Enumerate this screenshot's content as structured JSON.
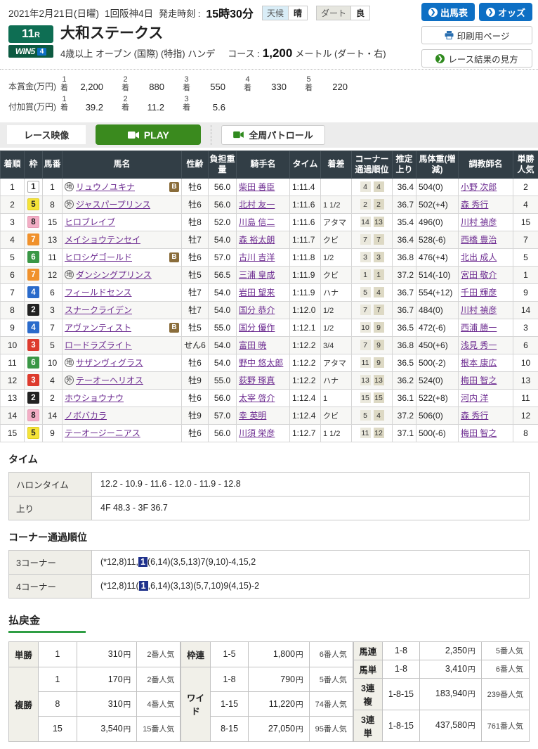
{
  "header": {
    "date": "2021年2月21日(日曜)",
    "meeting": "1回阪神4日",
    "start_label": "発走時刻 :",
    "start_time": "15時30分",
    "weather_label": "天候",
    "weather_value": "晴",
    "surface_label": "ダート",
    "surface_value": "良",
    "buttons": {
      "entries": "出馬表",
      "odds": "オッズ",
      "print": "印刷用ページ",
      "guide": "レース結果の見方"
    }
  },
  "race": {
    "number": "11",
    "number_suffix": "R",
    "win5_label": "WIN5",
    "win5_num": "4",
    "title": "大和ステークス",
    "conditions": "4歳以上  オープン (国際) (特指)  ハンデ",
    "course_label": "コース :",
    "course_value": "1,200",
    "course_unit": "メートル (ダート・右)"
  },
  "prizes": {
    "main_label": "本賞金(万円)",
    "extra_label": "付加賞(万円)",
    "rank_suffix": "着",
    "main": [
      {
        "rank": "1",
        "value": "2,200"
      },
      {
        "rank": "2",
        "value": "880"
      },
      {
        "rank": "3",
        "value": "550"
      },
      {
        "rank": "4",
        "value": "330"
      },
      {
        "rank": "5",
        "value": "220"
      }
    ],
    "extra": [
      {
        "rank": "1",
        "value": "39.2"
      },
      {
        "rank": "2",
        "value": "11.2"
      },
      {
        "rank": "3",
        "value": "5.6"
      }
    ]
  },
  "video": {
    "race_video": "レース映像",
    "play": "PLAY",
    "patrol": "全周パトロール"
  },
  "results": {
    "headers": [
      "着順",
      "枠",
      "馬番",
      "馬名",
      "性齢",
      "負担重量",
      "騎手名",
      "タイム",
      "着差",
      "コーナー通過順位",
      "推定上り",
      "馬体重(増減)",
      "調教師名",
      "単勝人気"
    ],
    "rows": [
      {
        "pos": "1",
        "frame": "1",
        "num": "1",
        "prefix": "地",
        "name": "リュウノユキナ",
        "blinker": true,
        "sexage": "牡6",
        "load": "56.0",
        "jockey": "柴田 善臣",
        "time": "1:11.4",
        "margin": "",
        "corners": [
          "4",
          "4"
        ],
        "last3f": "36.4",
        "weight": "504(0)",
        "trainer": "小野 次郎",
        "fav": "2"
      },
      {
        "pos": "2",
        "frame": "5",
        "num": "8",
        "prefix": "外",
        "name": "ジャスパープリンス",
        "blinker": false,
        "sexage": "牡6",
        "load": "56.0",
        "jockey": "北村 友一",
        "time": "1:11.6",
        "margin": "1 1/2",
        "corners": [
          "2",
          "2"
        ],
        "last3f": "36.7",
        "weight": "502(+4)",
        "trainer": "森 秀行",
        "fav": "4"
      },
      {
        "pos": "3",
        "frame": "8",
        "num": "15",
        "prefix": "",
        "name": "ヒロブレイブ",
        "blinker": false,
        "sexage": "牡8",
        "load": "52.0",
        "jockey": "川島 信二",
        "time": "1:11.6",
        "margin": "アタマ",
        "corners": [
          "14",
          "13"
        ],
        "last3f": "35.4",
        "weight": "496(0)",
        "trainer": "川村 禎彦",
        "fav": "15"
      },
      {
        "pos": "4",
        "frame": "7",
        "num": "13",
        "prefix": "",
        "name": "メイショウテンセイ",
        "blinker": false,
        "sexage": "牡7",
        "load": "54.0",
        "jockey": "森 裕太朗",
        "time": "1:11.7",
        "margin": "クビ",
        "corners": [
          "7",
          "7"
        ],
        "last3f": "36.4",
        "weight": "528(-6)",
        "trainer": "西橋 豊治",
        "fav": "7"
      },
      {
        "pos": "5",
        "frame": "6",
        "num": "11",
        "prefix": "",
        "name": "ヒロシゲゴールド",
        "blinker": true,
        "sexage": "牡6",
        "load": "57.0",
        "jockey": "古川 吉洋",
        "time": "1:11.8",
        "margin": "1/2",
        "corners": [
          "3",
          "3"
        ],
        "last3f": "36.8",
        "weight": "476(+4)",
        "trainer": "北出 成人",
        "fav": "5"
      },
      {
        "pos": "6",
        "frame": "7",
        "num": "12",
        "prefix": "地",
        "name": "ダンシングプリンス",
        "blinker": false,
        "sexage": "牡5",
        "load": "56.5",
        "jockey": "三浦 皇成",
        "time": "1:11.9",
        "margin": "クビ",
        "corners": [
          "1",
          "1"
        ],
        "last3f": "37.2",
        "weight": "514(-10)",
        "trainer": "宮田 敬介",
        "fav": "1"
      },
      {
        "pos": "7",
        "frame": "4",
        "num": "6",
        "prefix": "",
        "name": "フィールドセンス",
        "blinker": false,
        "sexage": "牡7",
        "load": "54.0",
        "jockey": "岩田 望来",
        "time": "1:11.9",
        "margin": "ハナ",
        "corners": [
          "5",
          "4"
        ],
        "last3f": "36.7",
        "weight": "554(+12)",
        "trainer": "千田 輝彦",
        "fav": "9"
      },
      {
        "pos": "8",
        "frame": "2",
        "num": "3",
        "prefix": "",
        "name": "スナークライデン",
        "blinker": false,
        "sexage": "牡7",
        "load": "54.0",
        "jockey": "国分 恭介",
        "time": "1:12.0",
        "margin": "1/2",
        "corners": [
          "7",
          "7"
        ],
        "last3f": "36.7",
        "weight": "484(0)",
        "trainer": "川村 禎彦",
        "fav": "14"
      },
      {
        "pos": "9",
        "frame": "4",
        "num": "7",
        "prefix": "",
        "name": "アヴァンティスト",
        "blinker": true,
        "sexage": "牡5",
        "load": "55.0",
        "jockey": "国分 優作",
        "time": "1:12.1",
        "margin": "1/2",
        "corners": [
          "10",
          "9"
        ],
        "last3f": "36.5",
        "weight": "472(-6)",
        "trainer": "西浦 勝一",
        "fav": "3"
      },
      {
        "pos": "10",
        "frame": "3",
        "num": "5",
        "prefix": "",
        "name": "ロードラズライト",
        "blinker": false,
        "sexage": "せん6",
        "load": "54.0",
        "jockey": "富田 暁",
        "time": "1:12.2",
        "margin": "3/4",
        "corners": [
          "7",
          "9"
        ],
        "last3f": "36.8",
        "weight": "450(+6)",
        "trainer": "浅見 秀一",
        "fav": "6"
      },
      {
        "pos": "11",
        "frame": "6",
        "num": "10",
        "prefix": "地",
        "name": "サザンヴィグラス",
        "blinker": false,
        "sexage": "牡6",
        "load": "54.0",
        "jockey": "野中 悠太郎",
        "time": "1:12.2",
        "margin": "アタマ",
        "corners": [
          "11",
          "9"
        ],
        "last3f": "36.5",
        "weight": "500(-2)",
        "trainer": "根本 康広",
        "fav": "10"
      },
      {
        "pos": "12",
        "frame": "3",
        "num": "4",
        "prefix": "外",
        "name": "テーオーヘリオス",
        "blinker": false,
        "sexage": "牡9",
        "load": "55.0",
        "jockey": "荻野 琢真",
        "time": "1:12.2",
        "margin": "ハナ",
        "corners": [
          "13",
          "13"
        ],
        "last3f": "36.2",
        "weight": "524(0)",
        "trainer": "梅田 智之",
        "fav": "13"
      },
      {
        "pos": "13",
        "frame": "2",
        "num": "2",
        "prefix": "",
        "name": "ホウショウナウ",
        "blinker": false,
        "sexage": "牡6",
        "load": "56.0",
        "jockey": "太宰 啓介",
        "time": "1:12.4",
        "margin": "1",
        "corners": [
          "15",
          "15"
        ],
        "last3f": "36.1",
        "weight": "522(+8)",
        "trainer": "河内 洋",
        "fav": "11"
      },
      {
        "pos": "14",
        "frame": "8",
        "num": "14",
        "prefix": "",
        "name": "ノボバカラ",
        "blinker": false,
        "sexage": "牡9",
        "load": "57.0",
        "jockey": "幸 英明",
        "time": "1:12.4",
        "margin": "クビ",
        "corners": [
          "5",
          "4"
        ],
        "last3f": "37.2",
        "weight": "506(0)",
        "trainer": "森 秀行",
        "fav": "12"
      },
      {
        "pos": "15",
        "frame": "5",
        "num": "9",
        "prefix": "",
        "name": "テーオージーニアス",
        "blinker": false,
        "sexage": "牡6",
        "load": "56.0",
        "jockey": "川須 栄彦",
        "time": "1:12.7",
        "margin": "1 1/2",
        "corners": [
          "11",
          "12"
        ],
        "last3f": "37.1",
        "weight": "500(-6)",
        "trainer": "梅田 智之",
        "fav": "8"
      }
    ]
  },
  "time_section": {
    "title": "タイム",
    "furlong_label": "ハロンタイム",
    "furlong": "12.2 - 10.9 - 11.6 - 12.0 - 11.9 - 12.8",
    "agari_label": "上り",
    "agari": "4F 48.3 - 3F 36.7"
  },
  "corner_section": {
    "title": "コーナー通過順位",
    "rows": [
      {
        "label": "3コーナー",
        "pre": "(*12,8)11,",
        "hl": "1",
        "post": "(6,14)(3,5,13)7(9,10)-4,15,2"
      },
      {
        "label": "4コーナー",
        "pre": "(*12,8)11(",
        "hl": "1",
        "post": ",6,14)(3,13)(5,7,10)9(4,15)-2"
      }
    ]
  },
  "payout": {
    "title": "払戻金",
    "yen": "円",
    "groups": [
      [
        {
          "type": "単勝",
          "rows": [
            [
              "1",
              "310",
              "2番人気"
            ]
          ]
        },
        {
          "type": "複勝",
          "rows": [
            [
              "1",
              "170",
              "2番人気"
            ],
            [
              "8",
              "310",
              "4番人気"
            ],
            [
              "15",
              "3,540",
              "15番人気"
            ]
          ]
        }
      ],
      [
        {
          "type": "枠連",
          "rows": [
            [
              "1-5",
              "1,800",
              "6番人気"
            ]
          ]
        },
        {
          "type": "ワイド",
          "rows": [
            [
              "1-8",
              "790",
              "5番人気"
            ],
            [
              "1-15",
              "11,220",
              "74番人気"
            ],
            [
              "8-15",
              "27,050",
              "95番人気"
            ]
          ]
        }
      ],
      [
        {
          "type": "馬連",
          "rows": [
            [
              "1-8",
              "2,350",
              "5番人気"
            ]
          ]
        },
        {
          "type": "馬単",
          "rows": [
            [
              "1-8",
              "3,410",
              "6番人気"
            ]
          ]
        },
        {
          "type": "3連複",
          "rows": [
            [
              "1-8-15",
              "183,940",
              "239番人気"
            ]
          ]
        },
        {
          "type": "3連単",
          "rows": [
            [
              "1-8-15",
              "437,580",
              "761番人気"
            ]
          ]
        }
      ]
    ]
  },
  "colors": {
    "frame": {
      "1": {
        "bg": "#ffffff",
        "fg": "#222222",
        "border": "#aaaaaa"
      },
      "2": {
        "bg": "#222222",
        "fg": "#ffffff",
        "border": "#222222"
      },
      "3": {
        "bg": "#dd3b2e",
        "fg": "#ffffff",
        "border": "#dd3b2e"
      },
      "4": {
        "bg": "#2a6bcb",
        "fg": "#ffffff",
        "border": "#2a6bcb"
      },
      "5": {
        "bg": "#f5e339",
        "fg": "#222222",
        "border": "#e0cf20"
      },
      "6": {
        "bg": "#3a9746",
        "fg": "#ffffff",
        "border": "#3a9746"
      },
      "7": {
        "bg": "#f0912c",
        "fg": "#ffffff",
        "border": "#f0912c"
      },
      "8": {
        "bg": "#f2aec5",
        "fg": "#222222",
        "border": "#e79cb6"
      }
    },
    "accent_green": "#2f9e44",
    "button_blue": "#0d6fc4",
    "play_green": "#3a8a1e",
    "header_slate": "#323e46",
    "highlight_navy": "#20328c"
  }
}
